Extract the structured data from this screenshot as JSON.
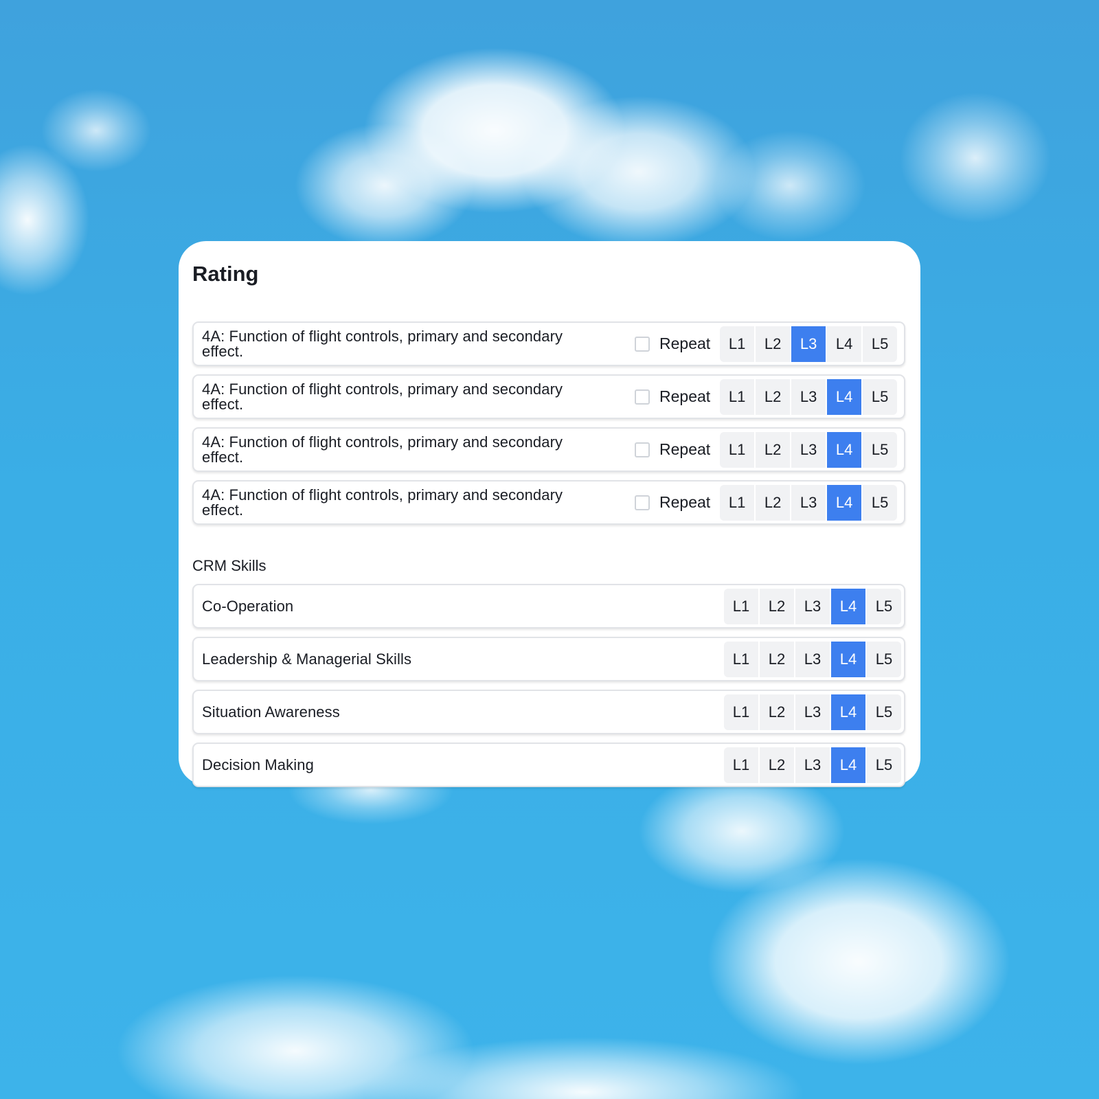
{
  "card": {
    "title": "Rating"
  },
  "competency_rows": [
    {
      "label": "4A: Function of flight controls, primary and secondary effect.",
      "repeat_label": "Repeat",
      "repeat_checked": false,
      "selected_level": "L3"
    },
    {
      "label": "4A: Function of flight controls, primary and secondary effect.",
      "repeat_label": "Repeat",
      "repeat_checked": false,
      "selected_level": "L4"
    },
    {
      "label": "4A: Function of flight controls, primary and secondary effect.",
      "repeat_label": "Repeat",
      "repeat_checked": false,
      "selected_level": "L4"
    },
    {
      "label": "4A: Function of flight controls, primary and secondary effect.",
      "repeat_label": "Repeat",
      "repeat_checked": false,
      "selected_level": "L4"
    }
  ],
  "crm": {
    "heading": "CRM Skills",
    "rows": [
      {
        "label": "Co-Operation",
        "selected_level": "L4"
      },
      {
        "label": "Leadership & Managerial Skills",
        "selected_level": "L4"
      },
      {
        "label": "Situation Awareness",
        "selected_level": "L4"
      },
      {
        "label": "Decision Making",
        "selected_level": "L4"
      }
    ]
  },
  "levels": [
    "L1",
    "L2",
    "L3",
    "L4",
    "L5"
  ],
  "colors": {
    "selected": "#3d7fef",
    "unselected": "#f1f2f4"
  }
}
